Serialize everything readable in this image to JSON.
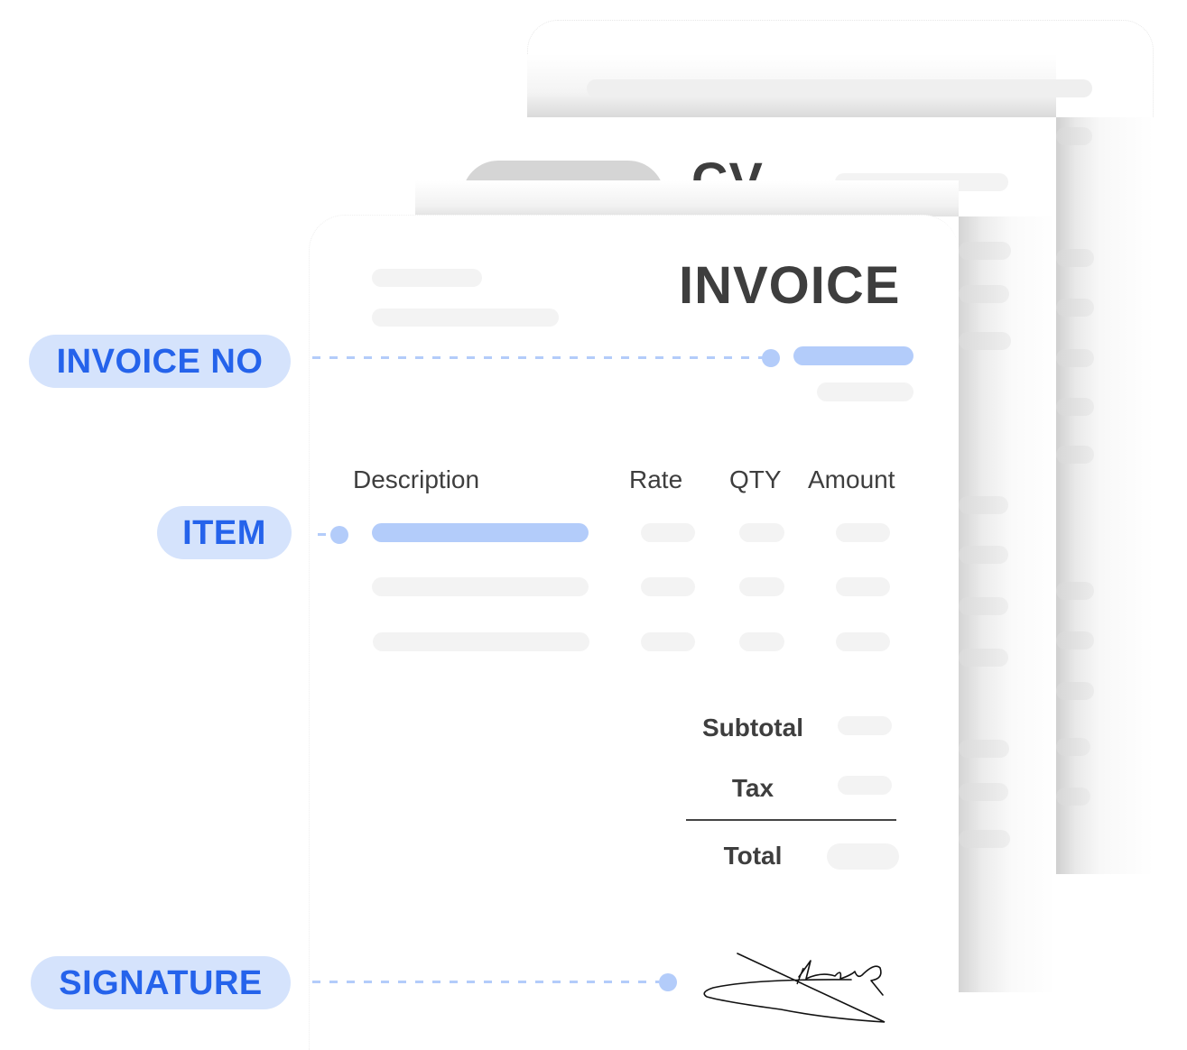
{
  "documents": {
    "back_page": {
      "label": ""
    },
    "cv_page": {
      "title": "CV"
    },
    "invoice_page": {
      "title": "INVOICE",
      "table_headers": [
        "Description",
        "Rate",
        "QTY",
        "Amount"
      ],
      "row_count": 3,
      "totals": {
        "subtotal_label": "Subtotal",
        "tax_label": "Tax",
        "total_label": "Total"
      }
    }
  },
  "callouts": [
    {
      "label": "INVOICE NO",
      "target": "invoice number field"
    },
    {
      "label": "ITEM",
      "target": "first line item"
    },
    {
      "label": "SIGNATURE",
      "target": "signature"
    }
  ],
  "colors": {
    "accent": "#2563eb",
    "pill_background": "#d5e3fc",
    "highlight_bar": "#b3ccfa",
    "placeholder_bar": "#f3f3f3",
    "heading_text": "#3e3e3e"
  }
}
